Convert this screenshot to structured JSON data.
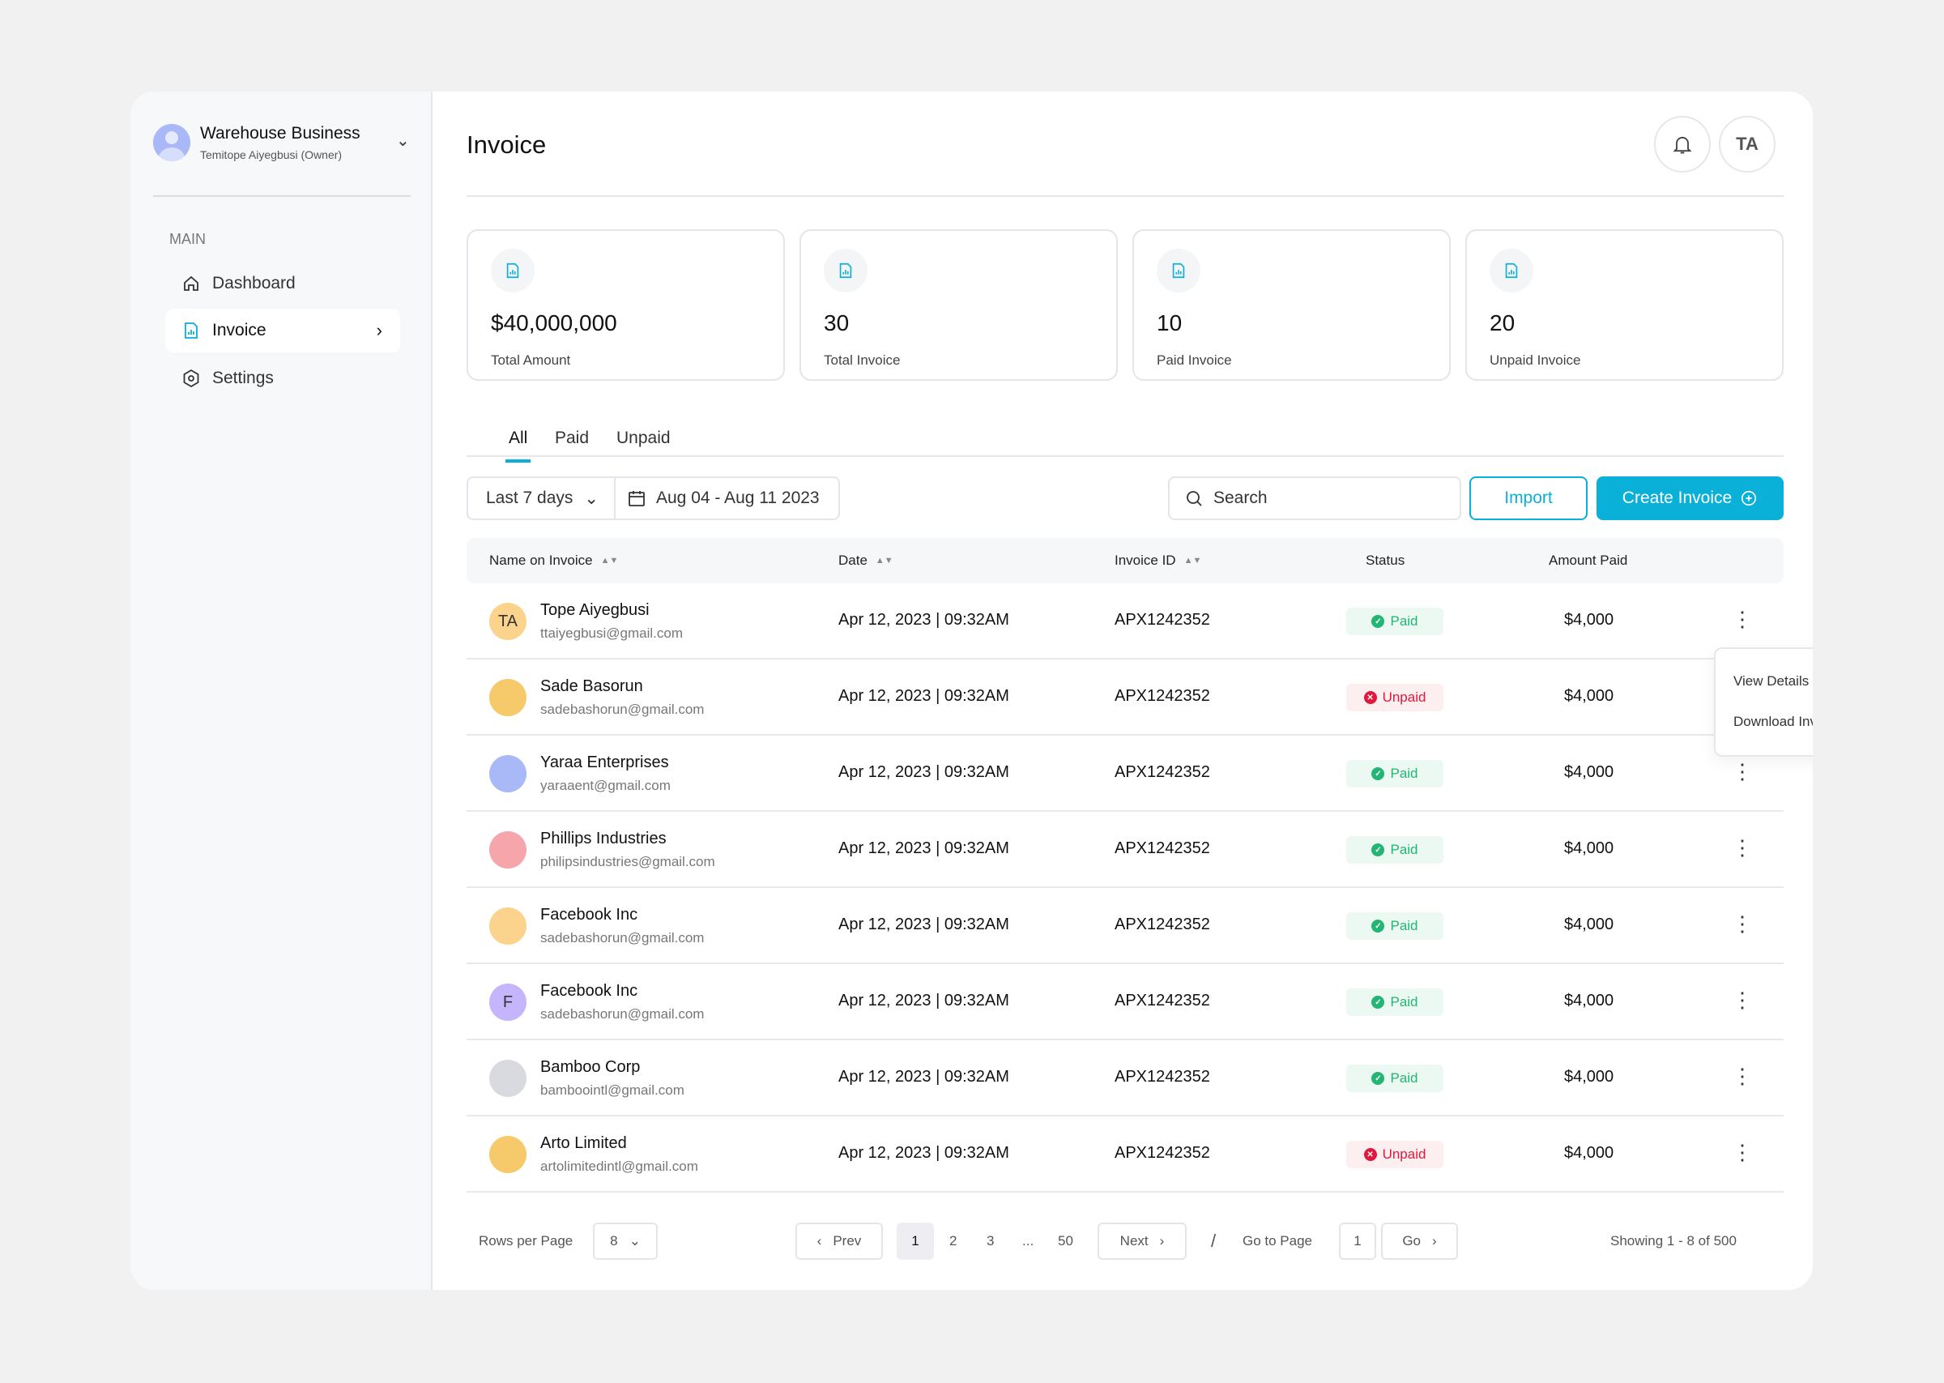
{
  "sidebar": {
    "workspace": "Warehouse Business",
    "owner": "Temitope Aiyegbusi (Owner)",
    "section": "MAIN",
    "items": [
      {
        "label": "Dashboard",
        "icon": "home-icon"
      },
      {
        "label": "Invoice",
        "icon": "invoice-icon"
      },
      {
        "label": "Settings",
        "icon": "settings-icon"
      }
    ]
  },
  "header": {
    "title": "Invoice",
    "avatar": "TA"
  },
  "stats": [
    {
      "value": "$40,000,000",
      "label": "Total Amount"
    },
    {
      "value": "30",
      "label": "Total Invoice"
    },
    {
      "value": "10",
      "label": "Paid Invoice"
    },
    {
      "value": "20",
      "label": "Unpaid Invoice"
    }
  ],
  "tabs": [
    "All",
    "Paid",
    "Unpaid"
  ],
  "filters": {
    "range": "Last 7 days",
    "dates": "Aug 04 - Aug 11 2023",
    "search_placeholder": "Search",
    "import": "Import",
    "create": "Create Invoice"
  },
  "table": {
    "headers": [
      "Name on Invoice",
      "Date",
      "Invoice ID",
      "Status",
      "Amount Paid"
    ],
    "rows": [
      {
        "initials": "TA",
        "name": "Tope Aiyegbusi",
        "email": "ttaiyegbusi@gmail.com",
        "date": "Apr 12, 2023 | 09:32AM",
        "id": "APX1242352",
        "status": "Paid",
        "amount": "$4,000",
        "avatar_color": "#fbd38d"
      },
      {
        "initials": "",
        "name": "Sade Basorun",
        "email": "sadebashorun@gmail.com",
        "date": "Apr 12, 2023 | 09:32AM",
        "id": "APX1242352",
        "status": "Unpaid",
        "amount": "$4,000",
        "avatar_color": "#f6c96a"
      },
      {
        "initials": "",
        "name": "Yaraa Enterprises",
        "email": "yaraaent@gmail.com",
        "date": "Apr 12, 2023 | 09:32AM",
        "id": "APX1242352",
        "status": "Paid",
        "amount": "$4,000",
        "avatar_color": "#a9b8f7"
      },
      {
        "initials": "",
        "name": "Phillips Industries",
        "email": "philipsindustries@gmail.com",
        "date": "Apr 12, 2023 | 09:32AM",
        "id": "APX1242352",
        "status": "Paid",
        "amount": "$4,000",
        "avatar_color": "#f6a5ab"
      },
      {
        "initials": "",
        "name": "Facebook Inc",
        "email": "sadebashorun@gmail.com",
        "date": "Apr 12, 2023 | 09:32AM",
        "id": "APX1242352",
        "status": "Paid",
        "amount": "$4,000",
        "avatar_color": "#fbd38d"
      },
      {
        "initials": "F",
        "name": "Facebook Inc",
        "email": "sadebashorun@gmail.com",
        "date": "Apr 12, 2023 | 09:32AM",
        "id": "APX1242352",
        "status": "Paid",
        "amount": "$4,000",
        "avatar_color": "#c4b5fd"
      },
      {
        "initials": "",
        "name": "Bamboo Corp",
        "email": "bambooint​l@gmail.com",
        "date": "Apr 12, 2023 | 09:32AM",
        "id": "APX1242352",
        "status": "Paid",
        "amount": "$4,000",
        "avatar_color": "#d9dadf"
      },
      {
        "initials": "",
        "name": "Arto Limited",
        "email": "artolimitedintl@gmail.com",
        "date": "Apr 12, 2023 | 09:32AM",
        "id": "APX1242352",
        "status": "Unpaid",
        "amount": "$4,000",
        "avatar_color": "#f6c96a"
      }
    ]
  },
  "row_menu": {
    "view": "View Details",
    "download": "Download Invoice"
  },
  "pagination": {
    "rows_label": "Rows per Page",
    "rows_value": "8",
    "prev": "Prev",
    "pages": [
      "1",
      "2",
      "3",
      "...",
      "50"
    ],
    "current": "1",
    "next": "Next",
    "slash": "/",
    "goto_label": "Go to Page",
    "goto_value": "1",
    "go": "Go",
    "showing": "Showing 1 - 8 of 500"
  },
  "colors": {
    "accent": "#0ab0d8",
    "paid": "#22b573",
    "unpaid": "#e0183d"
  }
}
